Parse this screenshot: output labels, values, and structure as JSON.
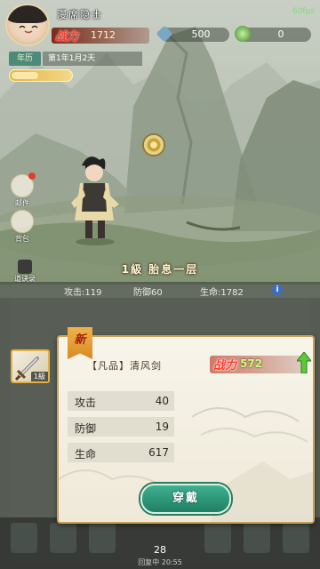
{
  "player": {
    "name": "漫席隐士",
    "power_label": "战力",
    "power": "1712"
  },
  "resources": [
    {
      "icon": "spirit-stone-icon",
      "value": "500"
    },
    {
      "icon": "green-orb-icon",
      "value": "0"
    }
  ],
  "fps": "60fps",
  "calendar": {
    "tag": "年历",
    "date": "第1年1月2天",
    "progress": 0.45
  },
  "side_menu": [
    {
      "label": "邮件",
      "badge": true
    },
    {
      "label": "背包",
      "badge": false
    },
    {
      "label": "道诀录",
      "badge": false
    }
  ],
  "realm": "1級  胎息一层",
  "stats": {
    "attack": "攻击:119",
    "defense": "防御60",
    "hp": "生命:1782",
    "info": "i"
  },
  "equipment_slot": {
    "icon": "sword-icon",
    "level": "1級"
  },
  "popup": {
    "new_tag": "新",
    "item_name": "【凡品】清风剑",
    "power_label": "战力",
    "power": "572",
    "attributes": [
      {
        "key": "攻击",
        "value": "40"
      },
      {
        "key": "防御",
        "value": "19"
      },
      {
        "key": "生命",
        "value": "617"
      }
    ],
    "equip_label": "穿戴"
  },
  "bottom": {
    "level": "28",
    "sub": "回复中 20:55"
  }
}
